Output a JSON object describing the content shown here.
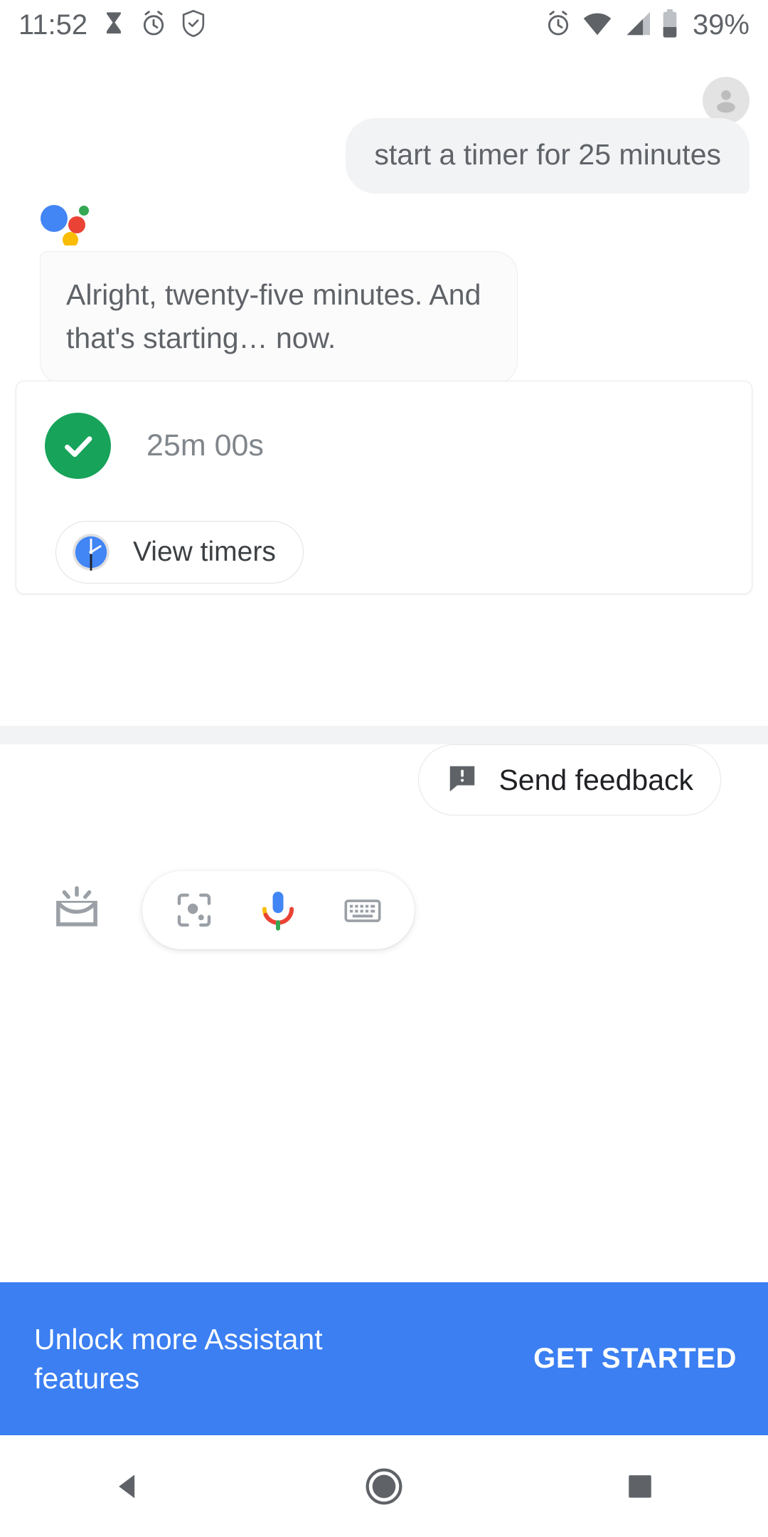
{
  "status_bar": {
    "time": "11:52",
    "battery_percent": "39%",
    "left_icons": [
      "hourglass-icon",
      "alarm-clock-icon",
      "shield-check-icon"
    ],
    "right_icons": [
      "alarm-clock-icon",
      "wifi-icon",
      "cell-signal-icon",
      "battery-icon"
    ]
  },
  "conversation": {
    "avatar_icon": "user-avatar-icon",
    "user_message": "start a timer for 25 minutes",
    "assistant_logo_icon": "google-assistant-logo",
    "assistant_message": "Alright, twenty-five minutes. And that's starting… now.",
    "timer_card": {
      "status_icon": "green-check-circle-icon",
      "duration": "25m 00s",
      "action_icon": "clock-icon",
      "action_label": "View timers"
    }
  },
  "footer": {
    "feedback_icon": "feedback-bubble-icon",
    "feedback_label": "Send feedback",
    "explore_icon": "keyboard-explore-icon",
    "lens_icon": "google-lens-icon",
    "mic_icon": "google-mic-icon",
    "keyboard_icon": "keyboard-icon"
  },
  "banner": {
    "message": "Unlock more Assistant features",
    "cta_label": "GET STARTED",
    "background_color": "#3b7ff2"
  },
  "nav_bar": {
    "back_icon": "back-triangle-icon",
    "home_icon": "home-circle-icon",
    "recents_icon": "recents-square-icon"
  },
  "colors": {
    "accent_blue": "#4285f4",
    "green": "#17a35a",
    "google_red": "#ea4335",
    "google_yellow": "#fbbc05",
    "google_green": "#34a853",
    "text_gray": "#5f6368"
  }
}
